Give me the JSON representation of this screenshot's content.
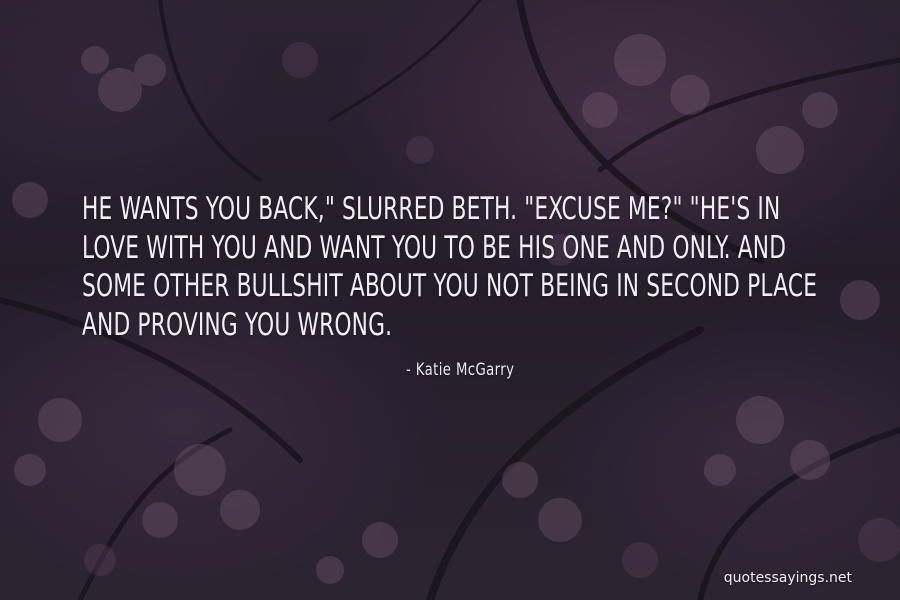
{
  "quote": {
    "text": "He wants you back,\" slurred Beth. \"Excuse me?\" \"He's in love with you and want you to be his one and only. And some other bullshit about you not being in second place and proving you wrong.",
    "author": "- Katie McGarry"
  },
  "watermark": {
    "text": "quotessayings.net"
  },
  "colors": {
    "text": "#f3eef5",
    "background": "#2d2534"
  }
}
